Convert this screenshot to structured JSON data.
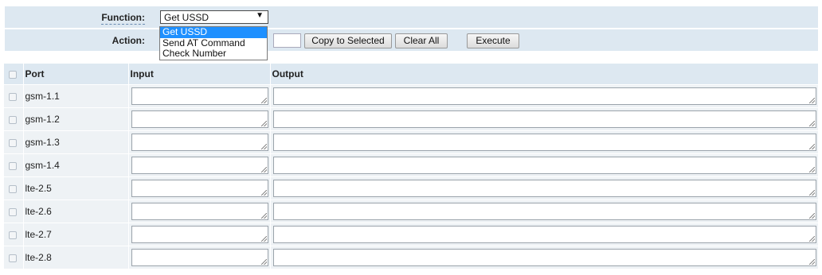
{
  "function_row": {
    "label": "Function:",
    "selected": "Get USSD",
    "arrow": "▼",
    "options": [
      "Get USSD",
      "Send AT Command",
      "Check Number"
    ]
  },
  "action_row": {
    "label": "Action:",
    "copy_button": "Copy to Selected",
    "clear_button": "Clear All",
    "execute_button": "Execute"
  },
  "table": {
    "headers": {
      "port": "Port",
      "input": "Input",
      "output": "Output"
    },
    "rows": [
      {
        "port": "gsm-1.1"
      },
      {
        "port": "gsm-1.2"
      },
      {
        "port": "gsm-1.3"
      },
      {
        "port": "gsm-1.4"
      },
      {
        "port": "lte-2.5"
      },
      {
        "port": "lte-2.6"
      },
      {
        "port": "lte-2.7"
      },
      {
        "port": "lte-2.8"
      }
    ]
  },
  "colors": {
    "header_bg": "#dde8f1",
    "row_bg": "#eef2f5",
    "dropdown_highlight": "#1e90ff"
  }
}
